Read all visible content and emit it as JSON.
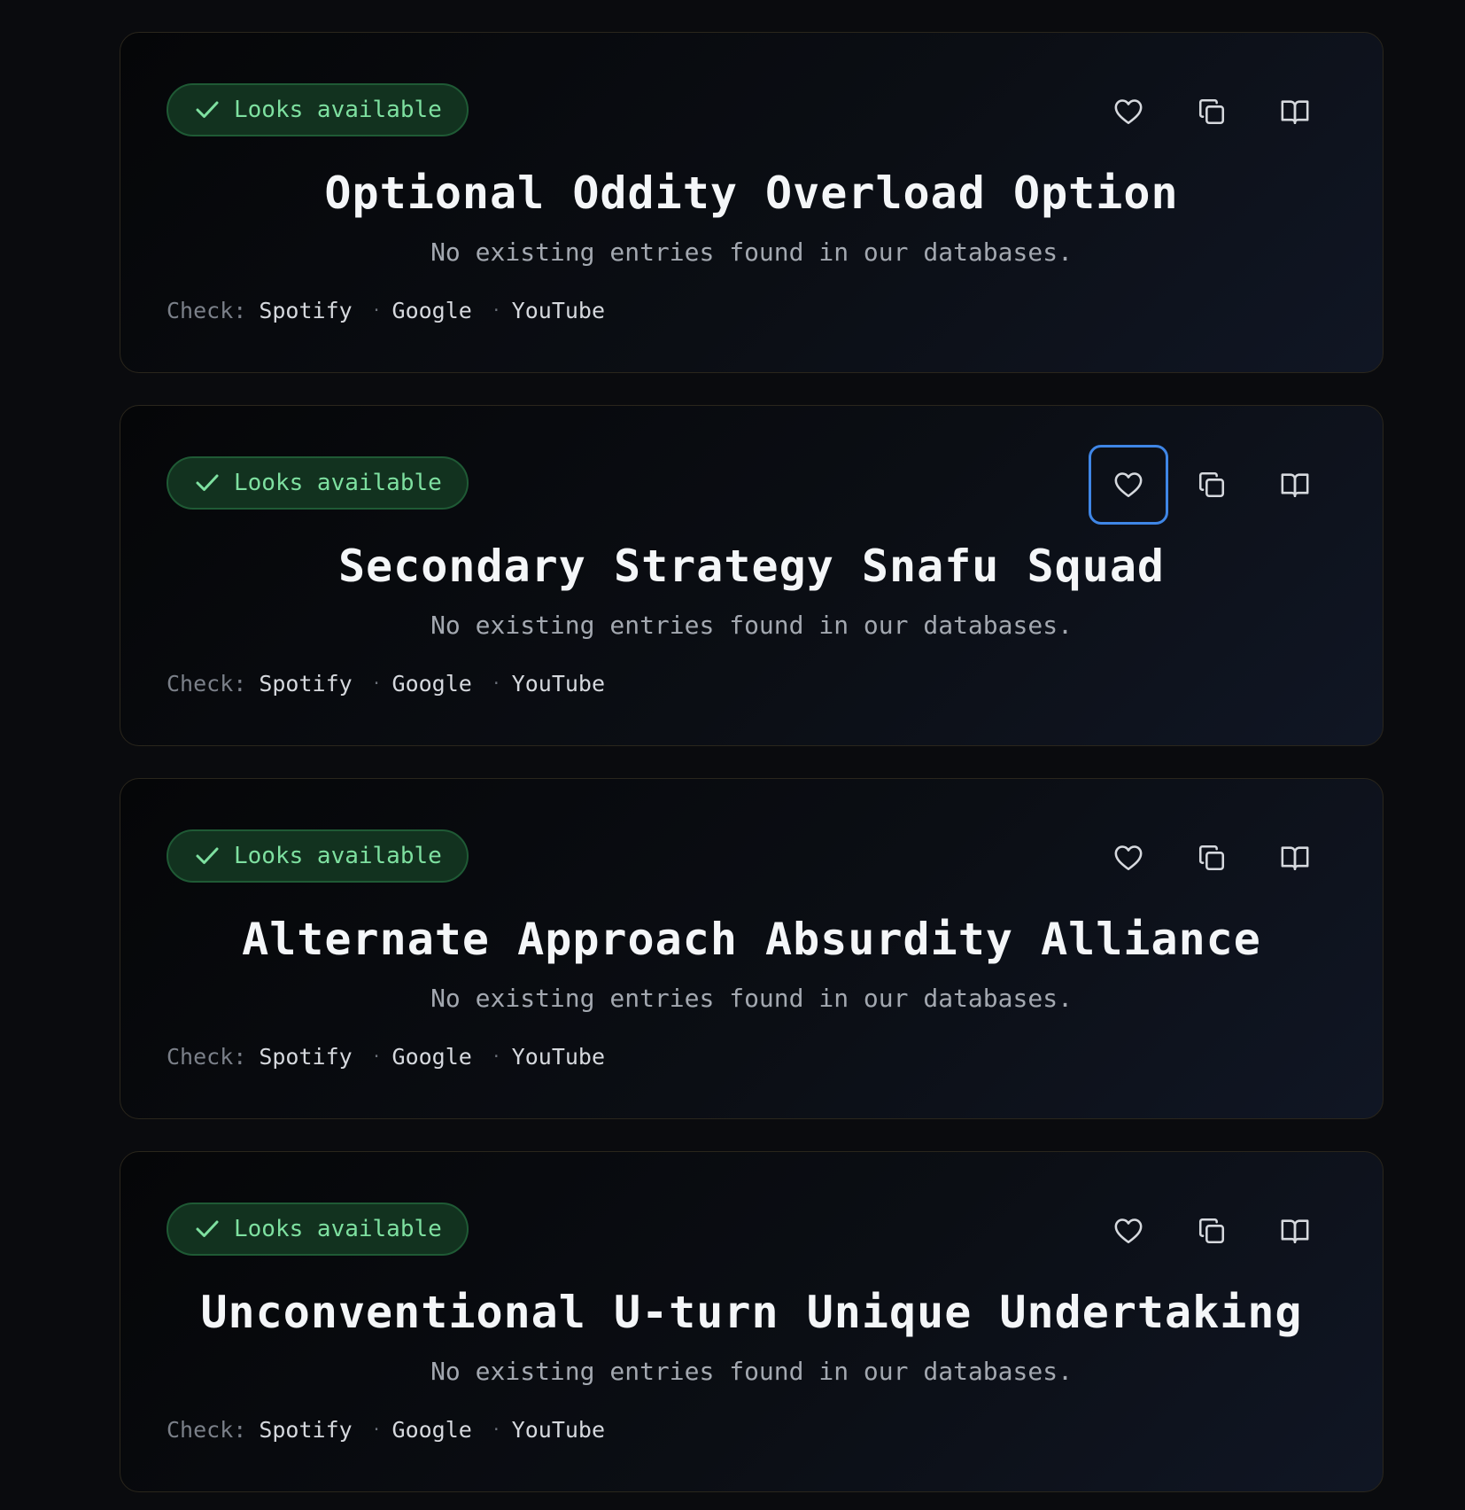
{
  "colors": {
    "badge_text": "#7ee0a0",
    "badge_bg": "#12321f",
    "focus_ring": "#3f86e6",
    "card_border": "#2a261c"
  },
  "icons": {
    "badge": "check-icon",
    "favorite": "heart-icon",
    "copy": "copy-icon",
    "dictionary": "book-open-icon"
  },
  "cards": [
    {
      "status": "Looks available",
      "title": "Optional Oddity Overload Option",
      "subtitle": "No existing entries found in our databases.",
      "check_label": "Check:",
      "links": [
        "Spotify",
        "Google",
        "YouTube"
      ]
    },
    {
      "status": "Looks available",
      "title": "Secondary Strategy Snafu Squad",
      "subtitle": "No existing entries found in our databases.",
      "check_label": "Check:",
      "links": [
        "Spotify",
        "Google",
        "YouTube"
      ]
    },
    {
      "status": "Looks available",
      "title": "Alternate Approach Absurdity Alliance",
      "subtitle": "No existing entries found in our databases.",
      "check_label": "Check:",
      "links": [
        "Spotify",
        "Google",
        "YouTube"
      ]
    },
    {
      "status": "Looks available",
      "title": "Unconventional U-turn Unique Undertaking",
      "subtitle": "No existing entries found in our databases.",
      "check_label": "Check:",
      "links": [
        "Spotify",
        "Google",
        "YouTube"
      ]
    }
  ]
}
